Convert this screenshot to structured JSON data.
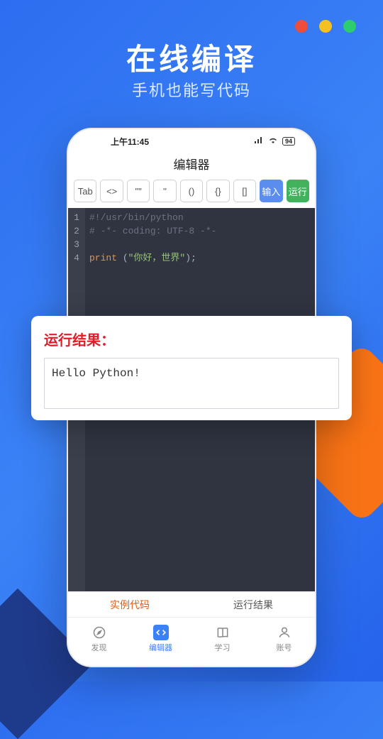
{
  "hero": {
    "title": "在线编译",
    "subtitle": "手机也能写代码"
  },
  "status": {
    "time": "上午11:45",
    "battery": "94"
  },
  "app": {
    "title": "编辑器"
  },
  "toolbar": {
    "tab": "Tab",
    "angle": "<>",
    "dquote": "\"\"",
    "squote": "''",
    "paren": "()",
    "brace": "{}",
    "bracket": "[]",
    "input": "输入",
    "run": "运行"
  },
  "code": {
    "l1": "#!/usr/bin/python",
    "l2": "# -*- coding: UTF-8 -*-",
    "l3": "",
    "l4_fn": "print",
    "l4_sp": " (",
    "l4_str": "\"你好，世界\"",
    "l4_end": ");"
  },
  "inner_tabs": {
    "example": "实例代码",
    "result": "运行结果"
  },
  "nav": {
    "discover": "发现",
    "editor": "编辑器",
    "learn": "学习",
    "account": "账号"
  },
  "result": {
    "title": "运行结果：",
    "output": "Hello Python!"
  }
}
